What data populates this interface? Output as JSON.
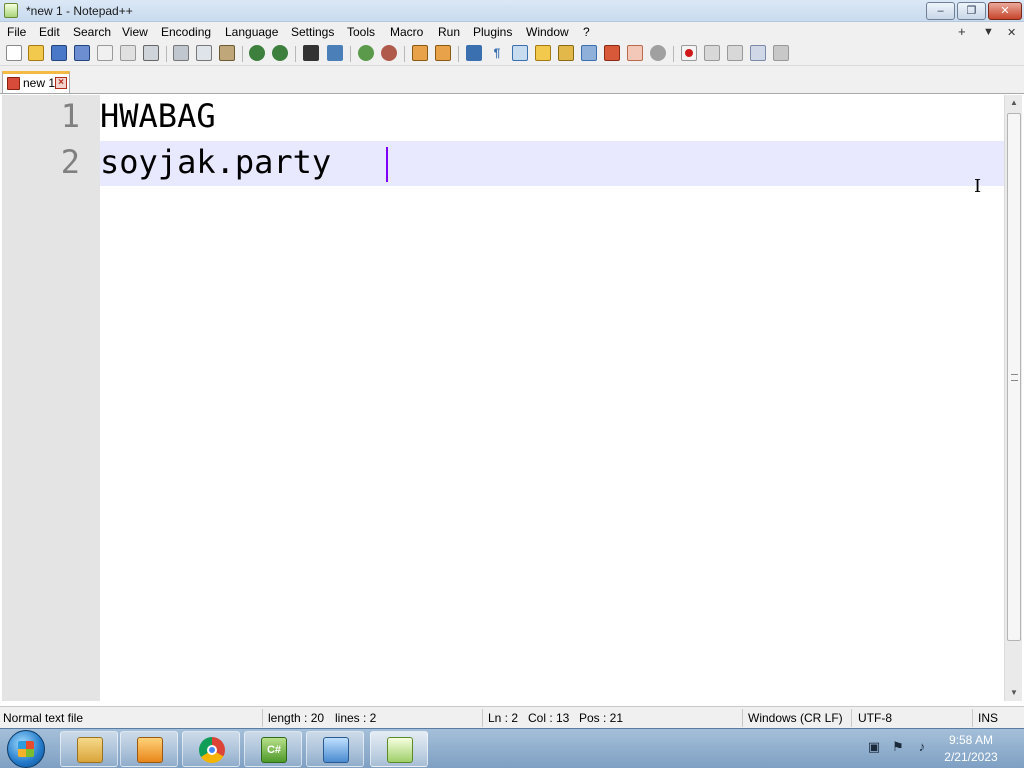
{
  "window": {
    "title": "*new 1 - Notepad++",
    "minimize_glyph": "–",
    "maximize_glyph": "❐",
    "close_glyph": "✕"
  },
  "menu": {
    "items": [
      "File",
      "Edit",
      "Search",
      "View",
      "Encoding",
      "Language",
      "Settings",
      "Tools",
      "Macro",
      "Run",
      "Plugins",
      "Window",
      "?"
    ],
    "right_controls": [
      "+",
      "▼",
      "✕"
    ]
  },
  "toolbar": {
    "icons": [
      "new-file-icon",
      "open-file-icon",
      "save-icon",
      "save-all-icon",
      "close-icon",
      "close-all-icon",
      "print-icon",
      "cut-icon",
      "copy-icon",
      "paste-icon",
      "undo-icon",
      "redo-icon",
      "find-icon",
      "replace-icon",
      "zoom-in-icon",
      "zoom-out-icon",
      "sync-vertical-icon",
      "sync-horizontal-icon",
      "word-wrap-icon",
      "show-all-characters-icon",
      "indent-guide-icon",
      "user-language-icon",
      "document-map-icon",
      "function-list-icon",
      "folder-workspace-icon",
      "monitoring-icon",
      "file-explorer-icon",
      "record-macro-icon",
      "stop-recording-icon",
      "playback-macro-icon",
      "run-macro-multiple-icon",
      "save-macro-icon"
    ]
  },
  "tabs": [
    {
      "label": "new 1",
      "unsaved": true
    }
  ],
  "editor": {
    "lines": [
      "HWABAG",
      "soyjak.party"
    ],
    "line_numbers": [
      "1",
      "2"
    ],
    "current_line": 2,
    "colors": {
      "gutter": "#e4e4e4",
      "line_number": "#808080",
      "current_line": "#e8e8ff",
      "caret": "#8000ff"
    }
  },
  "status": {
    "file_type": "Normal text file",
    "length": "length : 20",
    "lines": "lines : 2",
    "ln": "Ln : 2",
    "col": "Col : 13",
    "pos": "Pos : 21",
    "eol": "Windows (CR LF)",
    "encoding": "UTF-8",
    "mode": "INS"
  },
  "taskbar": {
    "apps": [
      "file-explorer-icon",
      "media-player-icon",
      "chrome-icon",
      "csharp-icon",
      "control-panel-icon",
      "notepad-plus-plus-icon"
    ],
    "active_app": "notepad-plus-plus-icon",
    "tray_icons": [
      "network-icon",
      "action-center-flag-icon",
      "volume-icon"
    ],
    "time": "9:58 AM",
    "date": "2/21/2023"
  }
}
